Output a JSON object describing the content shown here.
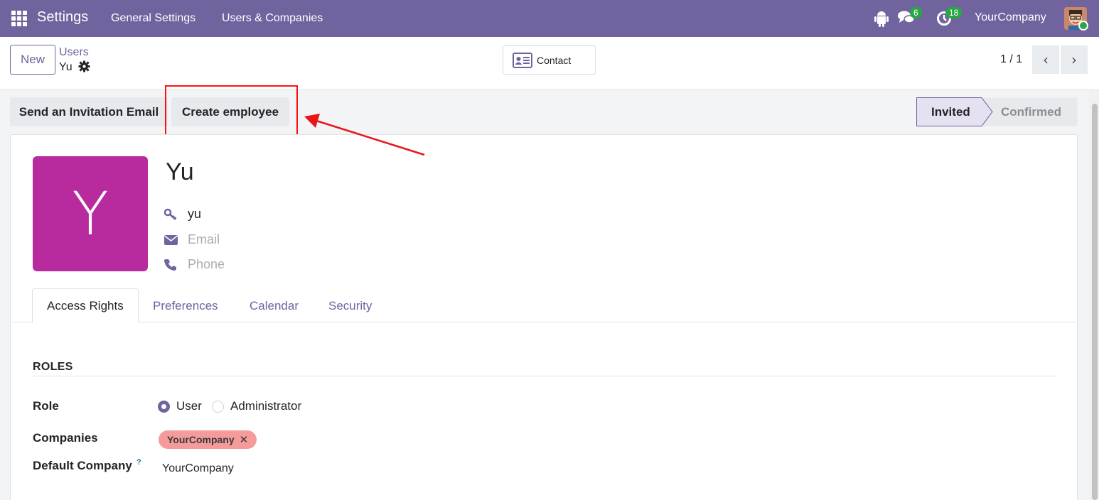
{
  "navbar": {
    "app_title": "Settings",
    "menu": [
      "General Settings",
      "Users & Companies"
    ],
    "messages_count": "6",
    "activities_count": "18",
    "company": "YourCompany"
  },
  "control_panel": {
    "new_label": "New",
    "breadcrumb_parent": "Users",
    "breadcrumb_current": "Yu",
    "contact_label": "Contact",
    "pager": "1 / 1",
    "prev_glyph": "‹",
    "next_glyph": "›"
  },
  "actions": {
    "send_invitation": "Send an Invitation Email",
    "create_employee": "Create employee"
  },
  "status": {
    "stages": [
      "Invited",
      "Confirmed"
    ],
    "current": "Invited"
  },
  "user": {
    "avatar_letter": "Y",
    "name": "Yu",
    "login": "yu",
    "email_placeholder": "Email",
    "phone_placeholder": "Phone"
  },
  "tabs": [
    "Access Rights",
    "Preferences",
    "Calendar",
    "Security"
  ],
  "roles": {
    "section_title": "ROLES",
    "role_label": "Role",
    "role_options": [
      "User",
      "Administrator"
    ],
    "role_selected": "User",
    "companies_label": "Companies",
    "companies": [
      "YourCompany"
    ],
    "tag_remove": "✕",
    "default_company_label": "Default Company",
    "help_mark": "?",
    "default_company": "YourCompany"
  },
  "colors": {
    "navbar": "#71639e",
    "avatar": "#b72b9e",
    "company_tag": "#f59b9b",
    "badge": "#28a745",
    "highlight": "#ff1010"
  }
}
